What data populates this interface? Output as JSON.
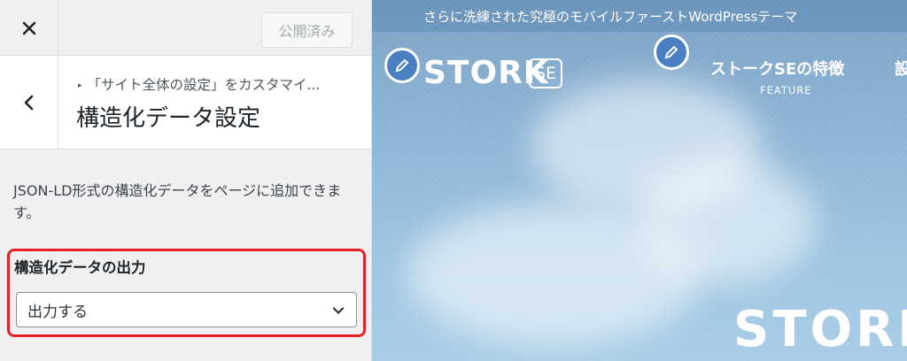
{
  "colors": {
    "highlight_border": "#e5212a",
    "badge_blue": "#4a7fc1",
    "sky_top": "#7ca1c4",
    "sky_bottom": "#a9cde7"
  },
  "topbar": {
    "close_icon": "close-icon",
    "publish_label": "公開済み"
  },
  "section": {
    "back_icon": "chevron-left-icon",
    "breadcrumb": "「サイト全体の設定」をカスタマイ...",
    "title": "構造化データ設定",
    "description": "JSON-LD形式の構造化データをページに追加できます。"
  },
  "control": {
    "label": "構造化データの出力",
    "selected_value": "出力する",
    "chevron_icon": "chevron-down-icon"
  },
  "preview": {
    "tagline": "さらに洗練された究極のモバイルファーストWordPressテーマ",
    "logo_text": "STORK",
    "logo_badge": "SE",
    "nav_item": "ストークSEの特徴",
    "nav_item_sub": "FEATURE",
    "nav_item_2": "設",
    "hero_text": "STORK S"
  }
}
